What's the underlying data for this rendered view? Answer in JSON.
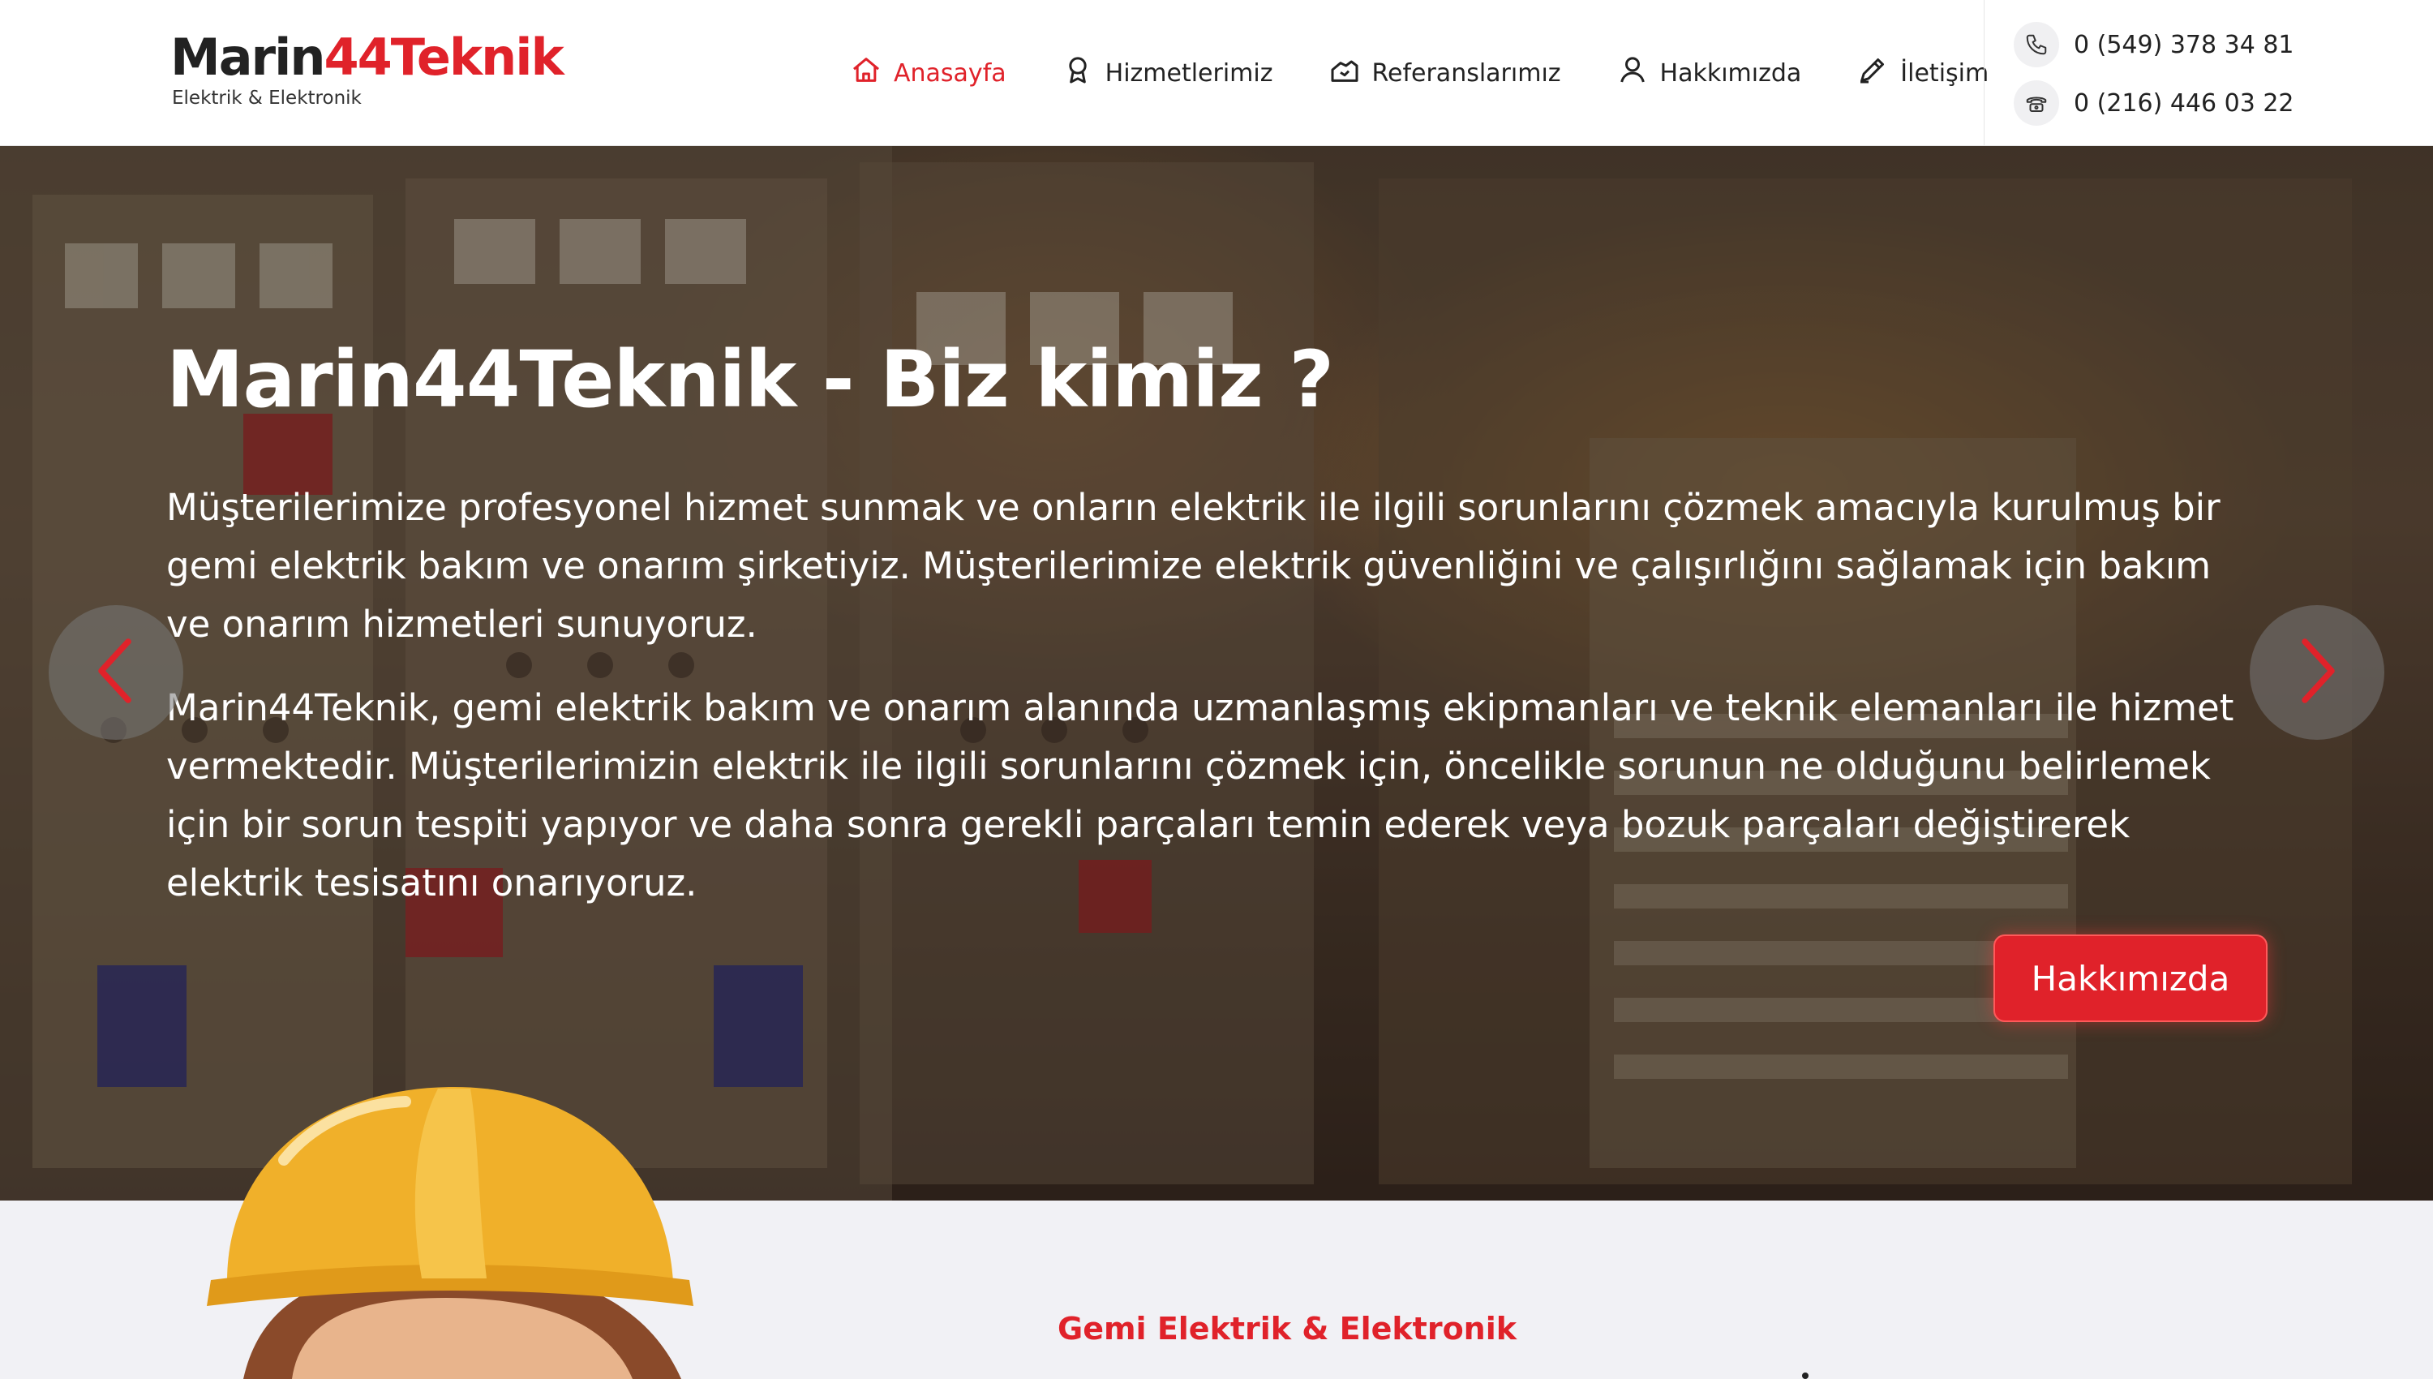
{
  "brand": {
    "name_dark": "Marin",
    "name_accent": "44Teknik",
    "tagline": "Elektrik & Elektronik",
    "accent_color": "#e0222a"
  },
  "nav": {
    "items": [
      {
        "label": "Anasayfa",
        "icon": "home-icon",
        "active": true
      },
      {
        "label": "Hizmetlerimiz",
        "icon": "award-icon",
        "active": false
      },
      {
        "label": "Referanslarımız",
        "icon": "handshake-icon",
        "active": false
      },
      {
        "label": "Hakkımızda",
        "icon": "user-icon",
        "active": false
      },
      {
        "label": "İletişim",
        "icon": "pen-icon",
        "active": false
      }
    ]
  },
  "contact": {
    "mobile": "0 (549) 378 34 81",
    "landline": "0 (216) 446 03 22"
  },
  "hero": {
    "title": "Marin44Teknik - Biz kimiz ?",
    "paragraph1": "Müşterilerimize profesyonel hizmet sunmak ve onların elektrik ile ilgili sorunlarını çözmek amacıyla kurulmuş bir gemi elektrik bakım ve onarım şirketiyiz. Müşterilerimize elektrik güvenliğini ve çalışırlığını sağlamak için bakım ve onarım hizmetleri sunuyoruz.",
    "paragraph2": "Marin44Teknik, gemi elektrik bakım ve onarım alanında uzmanlaşmış ekipmanları ve teknik elemanları ile hizmet vermektedir. Müşterilerimizin elektrik ile ilgili sorunlarını çözmek için, öncelikle sorunun ne olduğunu belirlemek için bir sorun tespiti yapıyor ve daha sonra gerekli parçaları temin ederek veya bozuk parçaları değiştirerek elektrik tesisatını onarıyoruz.",
    "button_label": "Hakkımızda"
  },
  "section": {
    "tag": "Gemi Elektrik & Elektronik"
  }
}
